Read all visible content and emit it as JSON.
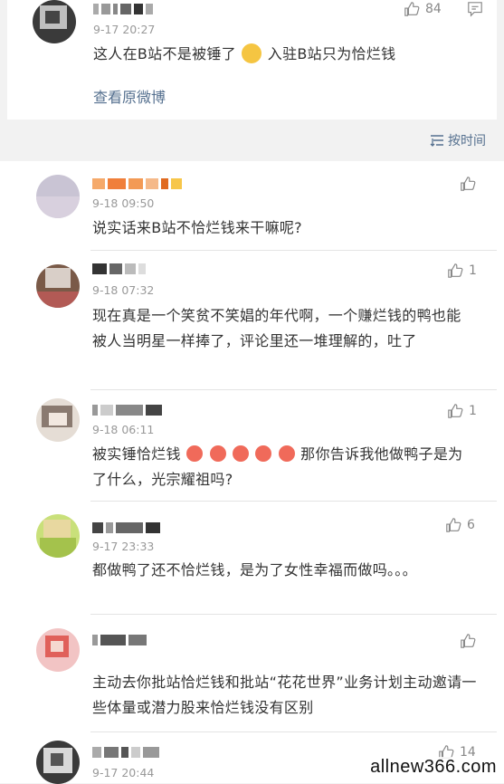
{
  "top_comment": {
    "time": "9-17 20:27",
    "likes": "84",
    "text": "这人在B站不是被锤了",
    "text_after": "入驻B站只为恰烂钱",
    "view_original": "查看原微博"
  },
  "sort_label": "按时间",
  "comments": [
    {
      "time": "9-18 09:50",
      "text": "说实话来B站不恰烂钱来干嘛呢?",
      "likes": ""
    },
    {
      "time": "9-18 07:32",
      "text": "现在真是一个笑贫不笑娼的年代啊，一个赚烂钱的鸭也能被人当明星一样捧了，评论里还一堆理解的，吐了",
      "likes": "1"
    },
    {
      "time": "9-18 06:11",
      "text_before": "被实锤恰烂钱",
      "text_after": "那你告诉我他做鸭子是为了什么，光宗耀祖吗?",
      "likes": "1"
    },
    {
      "time": "9-17 23:33",
      "text": "都做鸭了还不恰烂钱，是为了女性幸福而做吗。。。",
      "likes": "6"
    },
    {
      "time": "",
      "text": "主动去你批站恰烂钱和批站“花花世界”业务计划主动邀请一些体量或潜力股来恰烂钱没有区别",
      "likes": ""
    },
    {
      "time": "9-17 20:44",
      "text": "",
      "likes": "14"
    }
  ],
  "watermark": "allnew366.com",
  "colors": {
    "link": "#55708f",
    "text": "#333333",
    "meta": "#999999",
    "bg": "#f2f2f2"
  },
  "icons": [
    "thumbs-up-icon",
    "comment-icon",
    "sort-icon",
    "emoji-drool-icon",
    "emoji-laugh-icon"
  ]
}
